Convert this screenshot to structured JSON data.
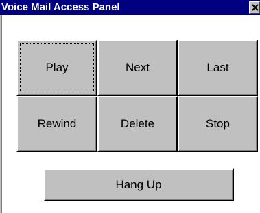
{
  "window": {
    "title": "Voice Mail Access Panel",
    "close_icon": "close-icon"
  },
  "controls": {
    "play_label": "Play",
    "next_label": "Next",
    "last_label": "Last",
    "rewind_label": "Rewind",
    "delete_label": "Delete",
    "stop_label": "Stop"
  },
  "hangup": {
    "label": "Hang Up"
  },
  "colors": {
    "title_bar": "#000080",
    "button_face": "#c0c0c0",
    "background": "#ffffff"
  }
}
